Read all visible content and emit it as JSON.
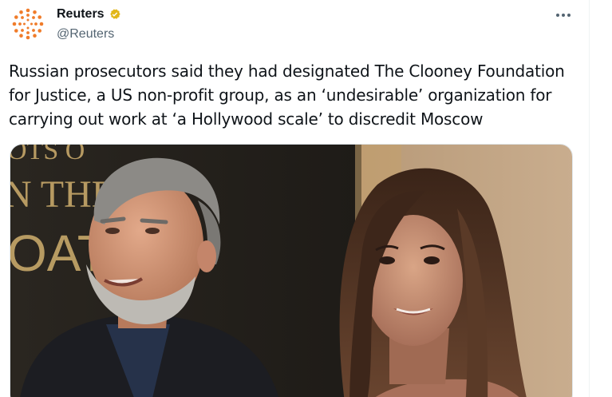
{
  "account": {
    "display_name": "Reuters",
    "handle": "@Reuters",
    "verified_icon": "verified-gold-badge-icon",
    "avatar_icon": "reuters-logo-icon"
  },
  "menu": {
    "more_icon": "more-horizontal-icon"
  },
  "tweet": {
    "text": "Russian prosecutors said they had designated The Clooney Foundation\nfor Justice, a US non-profit group, as an ‘undesirable’ organization for\ncarrying out work at ‘a Hollywood scale’ to discredit Moscow"
  },
  "media": {
    "backdrop_text": [
      "OTS O",
      "N THE",
      "OAT"
    ]
  },
  "colors": {
    "reuters_orange": "#f07c2a",
    "verified_gold": "#e2b719",
    "text_primary": "#0f1419",
    "text_secondary": "#536471"
  }
}
